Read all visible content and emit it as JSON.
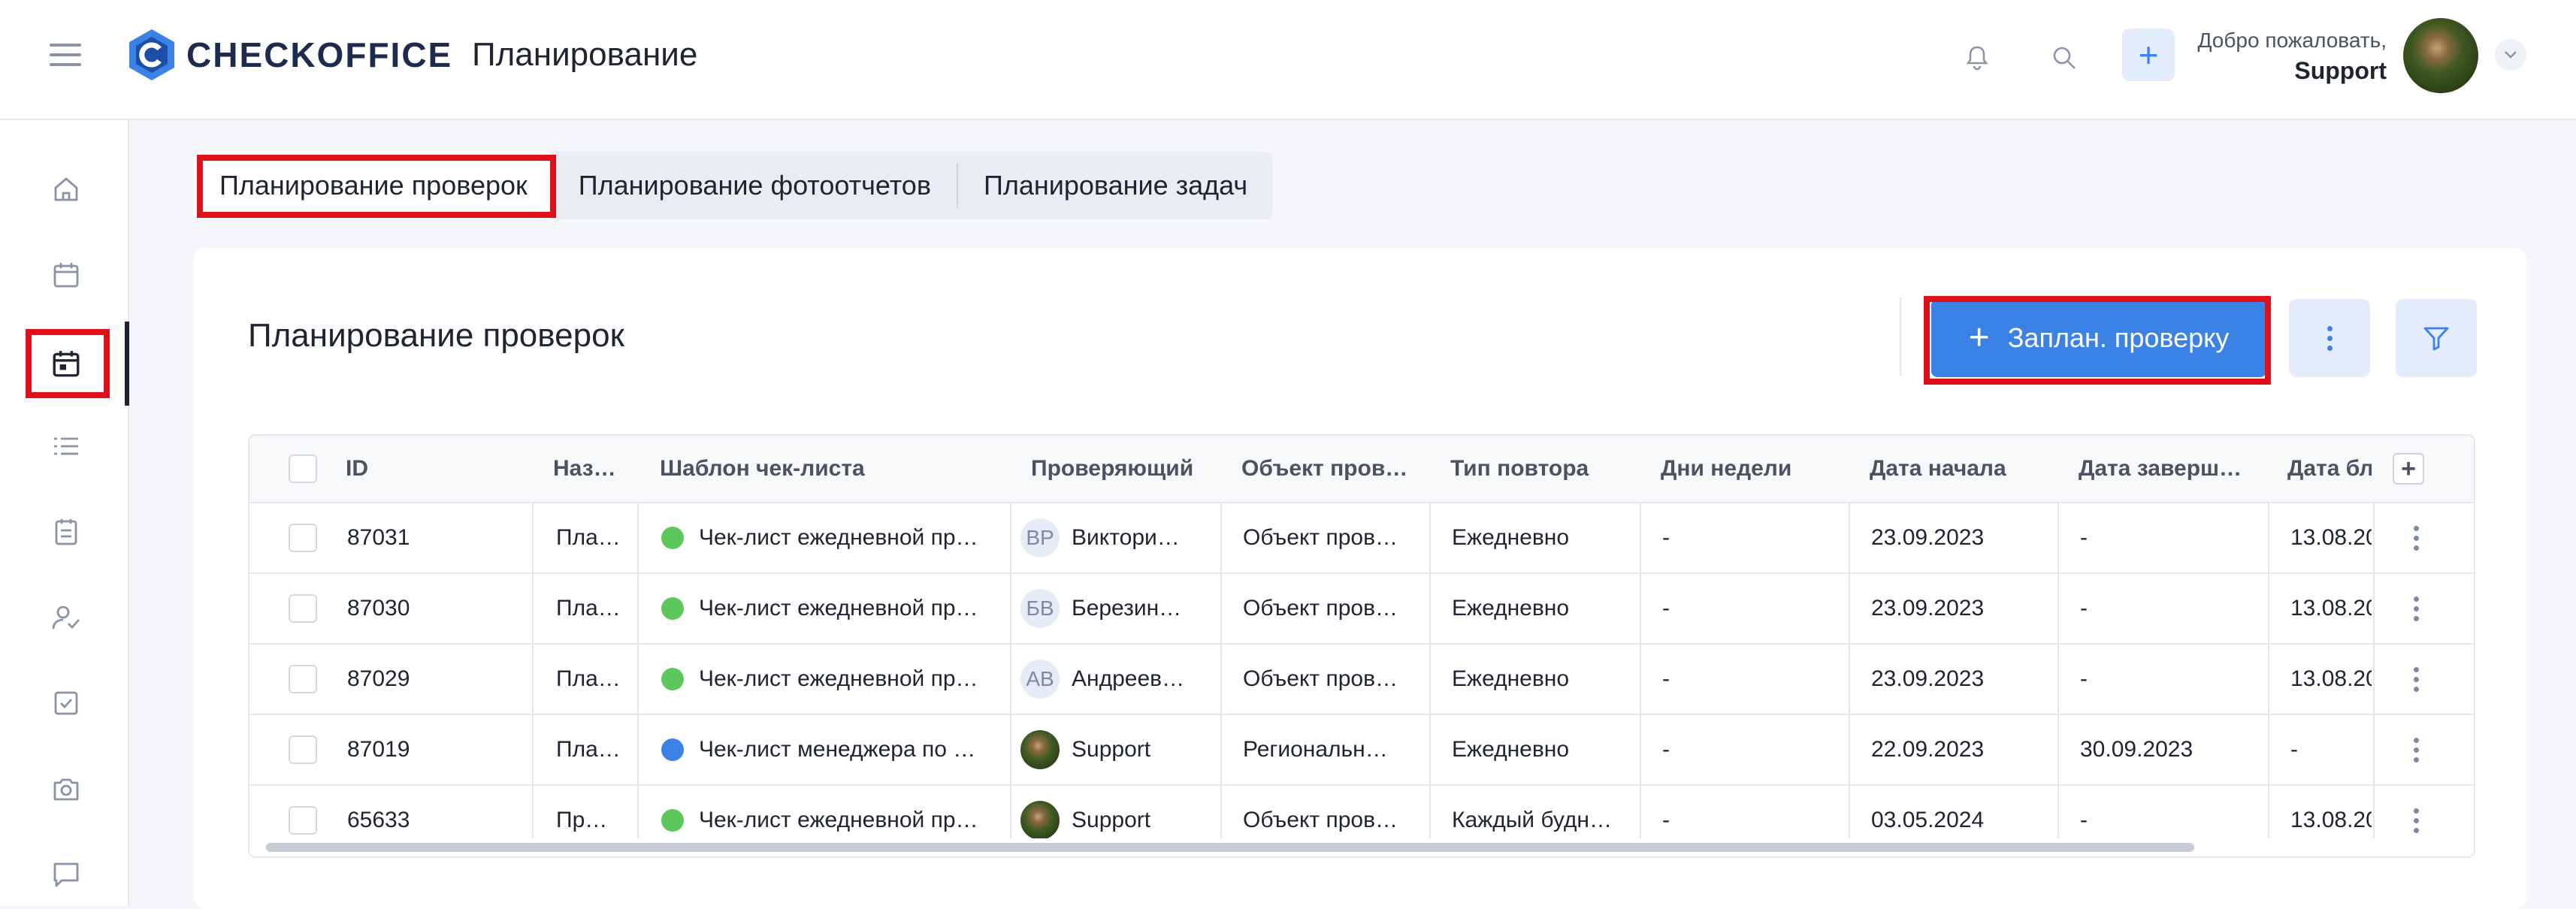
{
  "header": {
    "brand": "CHECKOFFICE",
    "title": "Планирование",
    "welcome": "Добро пожаловать,",
    "user": "Support"
  },
  "sidebar": {
    "items": [
      {
        "icon": "home-icon"
      },
      {
        "icon": "calendar-icon"
      },
      {
        "icon": "calendar-check-icon",
        "active": true
      },
      {
        "icon": "list-icon"
      },
      {
        "icon": "clipboard-icon"
      },
      {
        "icon": "user-check-icon"
      },
      {
        "icon": "checkbox-icon"
      },
      {
        "icon": "camera-icon"
      },
      {
        "icon": "chat-icon"
      }
    ]
  },
  "tabs": [
    "Планирование проверок",
    "Планирование фотоотчетов",
    "Планирование задач"
  ],
  "card": {
    "title": "Планирование проверок",
    "primary_button": "Заплан. проверку"
  },
  "table": {
    "columns": [
      "ID",
      "Наз…",
      "Шаблон чек-листа",
      "Проверяющий",
      "Объект пров…",
      "Тип повтора",
      "Дни недели",
      "Дата начала",
      "Дата заверш…",
      "Дата бл"
    ],
    "rows": [
      {
        "id": "87031",
        "name": "Пла…",
        "template": "Чек-лист ежедневной пр…",
        "dot": "#5cc85c",
        "init": "ВР",
        "inspector": "Виктори…",
        "object": "Объект пров…",
        "repeat": "Ежедневно",
        "days": "-",
        "start": "23.09.2023",
        "end": "-",
        "block": "13.08.20"
      },
      {
        "id": "87030",
        "name": "Пла…",
        "template": "Чек-лист ежедневной пр…",
        "dot": "#5cc85c",
        "init": "БВ",
        "inspector": "Березин…",
        "object": "Объект пров…",
        "repeat": "Ежедневно",
        "days": "-",
        "start": "23.09.2023",
        "end": "-",
        "block": "13.08.20"
      },
      {
        "id": "87029",
        "name": "Пла…",
        "template": "Чек-лист ежедневной пр…",
        "dot": "#5cc85c",
        "init": "АВ",
        "inspector": "Андреев…",
        "object": "Объект пров…",
        "repeat": "Ежедневно",
        "days": "-",
        "start": "23.09.2023",
        "end": "-",
        "block": "13.08.20"
      },
      {
        "id": "87019",
        "name": "Пла…",
        "template": "Чек-лист менеджера по …",
        "dot": "#3b82e6",
        "init": "",
        "inspector": "Support",
        "object": "Региональн…",
        "repeat": "Ежедневно",
        "days": "-",
        "start": "22.09.2023",
        "end": "30.09.2023",
        "block": "-"
      },
      {
        "id": "65633",
        "name": "Пр…",
        "template": "Чек-лист ежедневной пр…",
        "dot": "#5cc85c",
        "init": "",
        "inspector": "Support",
        "object": "Объект пров…",
        "repeat": "Каждый будн…",
        "days": "-",
        "start": "03.05.2024",
        "end": "-",
        "block": "13.08.20"
      }
    ]
  }
}
